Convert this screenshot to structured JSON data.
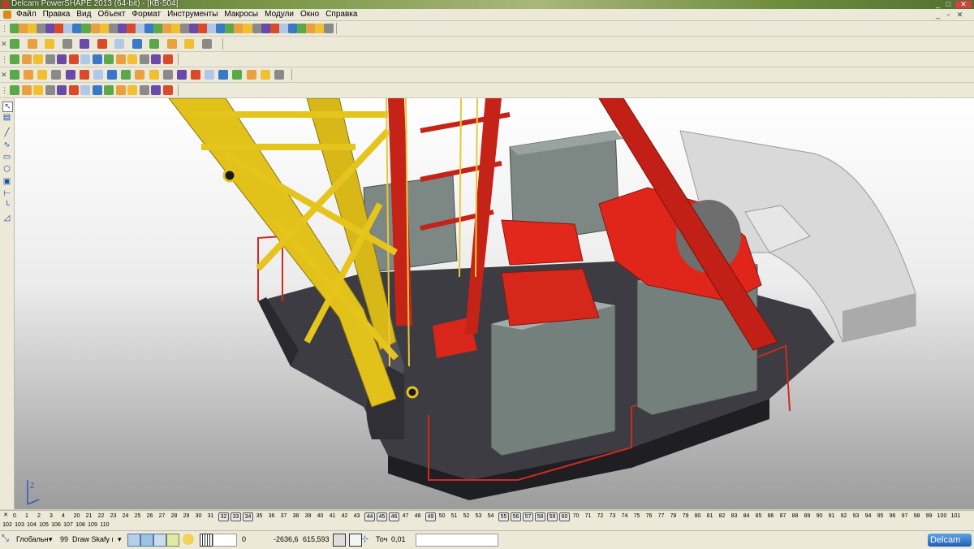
{
  "window": {
    "title": "Delcam PowerSHAPE 2013 (64-bit) - [КВ-504]"
  },
  "menu": [
    "Файл",
    "Правка",
    "Вид",
    "Объект",
    "Формат",
    "Инструменты",
    "Макросы",
    "Модули",
    "Окно",
    "Справка"
  ],
  "axes_label": "Z",
  "levels": {
    "row1": [
      {
        "t": "0"
      },
      {
        "t": "1"
      },
      {
        "t": "2"
      },
      {
        "t": "3"
      },
      {
        "t": "4"
      },
      {
        "t": "20"
      },
      {
        "t": "21"
      },
      {
        "t": "22"
      },
      {
        "t": "23"
      },
      {
        "t": "24"
      },
      {
        "t": "25"
      },
      {
        "t": "26"
      },
      {
        "t": "27"
      },
      {
        "t": "28"
      },
      {
        "t": "29"
      },
      {
        "t": "30"
      },
      {
        "t": "31"
      },
      {
        "t": "32",
        "boxed": true
      },
      {
        "t": "33",
        "boxed": true
      },
      {
        "t": "34",
        "boxed": true
      },
      {
        "t": "35"
      },
      {
        "t": "36"
      },
      {
        "t": "37"
      },
      {
        "t": "38"
      },
      {
        "t": "39"
      },
      {
        "t": "40"
      },
      {
        "t": "41"
      },
      {
        "t": "42"
      },
      {
        "t": "43"
      },
      {
        "t": "44",
        "boxed": true
      },
      {
        "t": "45",
        "boxed": true
      },
      {
        "t": "46",
        "boxed": true
      },
      {
        "t": "47"
      },
      {
        "t": "48"
      },
      {
        "t": "49",
        "boxed": true
      },
      {
        "t": "50"
      },
      {
        "t": "51"
      },
      {
        "t": "52"
      },
      {
        "t": "53"
      },
      {
        "t": "54"
      },
      {
        "t": "55",
        "boxed": true
      },
      {
        "t": "56",
        "boxed": true
      },
      {
        "t": "57",
        "boxed": true
      },
      {
        "t": "58",
        "boxed": true
      },
      {
        "t": "59",
        "boxed": true
      },
      {
        "t": "60",
        "boxed": true
      },
      {
        "t": "70"
      },
      {
        "t": "71"
      },
      {
        "t": "72"
      },
      {
        "t": "73"
      },
      {
        "t": "74"
      },
      {
        "t": "75"
      },
      {
        "t": "76"
      },
      {
        "t": "77"
      },
      {
        "t": "78"
      },
      {
        "t": "79"
      },
      {
        "t": "80"
      },
      {
        "t": "81"
      },
      {
        "t": "82"
      },
      {
        "t": "83"
      },
      {
        "t": "84"
      },
      {
        "t": "85"
      },
      {
        "t": "86"
      },
      {
        "t": "87"
      },
      {
        "t": "88"
      },
      {
        "t": "89"
      },
      {
        "t": "90"
      },
      {
        "t": "91"
      },
      {
        "t": "92"
      },
      {
        "t": "93"
      },
      {
        "t": "94"
      },
      {
        "t": "95"
      },
      {
        "t": "96"
      },
      {
        "t": "97"
      },
      {
        "t": "98"
      },
      {
        "t": "99"
      },
      {
        "t": "100"
      },
      {
        "t": "101"
      }
    ],
    "row2": [
      "102",
      "103",
      "104",
      "105",
      "106",
      "107",
      "108",
      "109",
      "110"
    ]
  },
  "status": {
    "workplane": "Глобальн",
    "level": "99",
    "level_name": "Draw Skafy ι",
    "field0": "0",
    "x": "-2636,6",
    "y": "615,593",
    "tol_label": "Точ",
    "tol": "0,01",
    "brand": "Delcam"
  }
}
